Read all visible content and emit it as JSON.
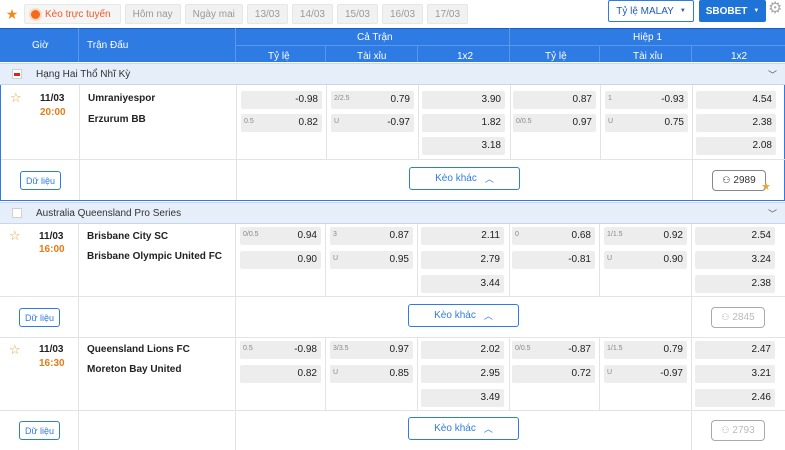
{
  "topbar": {
    "live_label": "Kèo trực tuyến",
    "date_tabs": [
      "Hôm nay",
      "Ngày mai",
      "13/03",
      "14/03",
      "15/03",
      "16/03",
      "17/03"
    ],
    "odds_type": "Tỷ lệ MALAY",
    "bookmaker": "SBOBET"
  },
  "header": {
    "time": "Giờ",
    "match": "Trận Đấu",
    "full_match": "Cả Trận",
    "first_half": "Hiệp 1",
    "handicap": "Tỷ lệ",
    "over_under": "Tài xỉu",
    "one_x_two": "1x2"
  },
  "buttons": {
    "data": "Dữ liệu",
    "more_odds": "Kèo khác"
  },
  "leagues": [
    {
      "name": "Hạng Hai Thổ Nhĩ Kỳ"
    },
    {
      "name": "Australia Queensland Pro Series"
    }
  ],
  "matches": [
    {
      "date": "11/03",
      "time": "20:00",
      "home": "Umraniyespor",
      "away": "Erzurum BB",
      "ft_hdp": [
        {
          "hc": "",
          "odd": "-0.98"
        },
        {
          "hc": "0.5",
          "odd": "0.82"
        }
      ],
      "ft_ou": [
        {
          "hc": "2/2.5",
          "odd": "0.79"
        },
        {
          "hc": "U",
          "odd": "-0.97"
        }
      ],
      "ft_1x2": [
        "3.90",
        "1.82",
        "3.18"
      ],
      "h1_hdp": [
        {
          "hc": "",
          "odd": "0.87"
        },
        {
          "hc": "0/0.5",
          "odd": "0.97"
        }
      ],
      "h1_ou": [
        {
          "hc": "1",
          "odd": "-0.93"
        },
        {
          "hc": "U",
          "odd": "0.75"
        }
      ],
      "h1_1x2": [
        "4.54",
        "2.38",
        "2.08"
      ],
      "count": "2989"
    },
    {
      "date": "11/03",
      "time": "16:00",
      "home": "Brisbane City SC",
      "away": "Brisbane Olympic United FC",
      "ft_hdp": [
        {
          "hc": "0/0.5",
          "odd": "0.94"
        },
        {
          "hc": "",
          "odd": "0.90"
        }
      ],
      "ft_ou": [
        {
          "hc": "3",
          "odd": "0.87"
        },
        {
          "hc": "U",
          "odd": "0.95"
        }
      ],
      "ft_1x2": [
        "2.11",
        "2.79",
        "3.44"
      ],
      "h1_hdp": [
        {
          "hc": "0",
          "odd": "0.68"
        },
        {
          "hc": "",
          "odd": "-0.81"
        }
      ],
      "h1_ou": [
        {
          "hc": "1/1.5",
          "odd": "0.92"
        },
        {
          "hc": "U",
          "odd": "0.90"
        }
      ],
      "h1_1x2": [
        "2.54",
        "3.24",
        "2.38"
      ],
      "count": "2845"
    },
    {
      "date": "11/03",
      "time": "16:30",
      "home": "Queensland Lions FC",
      "away": "Moreton Bay United",
      "ft_hdp": [
        {
          "hc": "0.5",
          "odd": "-0.98"
        },
        {
          "hc": "",
          "odd": "0.82"
        }
      ],
      "ft_ou": [
        {
          "hc": "3/3.5",
          "odd": "0.97"
        },
        {
          "hc": "U",
          "odd": "0.85"
        }
      ],
      "ft_1x2": [
        "2.02",
        "2.95",
        "3.49"
      ],
      "h1_hdp": [
        {
          "hc": "0/0.5",
          "odd": "-0.87"
        },
        {
          "hc": "",
          "odd": "0.72"
        }
      ],
      "h1_ou": [
        {
          "hc": "1/1.5",
          "odd": "0.79"
        },
        {
          "hc": "U",
          "odd": "-0.97"
        }
      ],
      "h1_1x2": [
        "2.47",
        "3.21",
        "2.46"
      ],
      "count": "2793"
    }
  ],
  "colors": {
    "header_blue": "#2e7be3",
    "accent_orange": "#e57b16",
    "league_bg": "#e6eefa"
  }
}
